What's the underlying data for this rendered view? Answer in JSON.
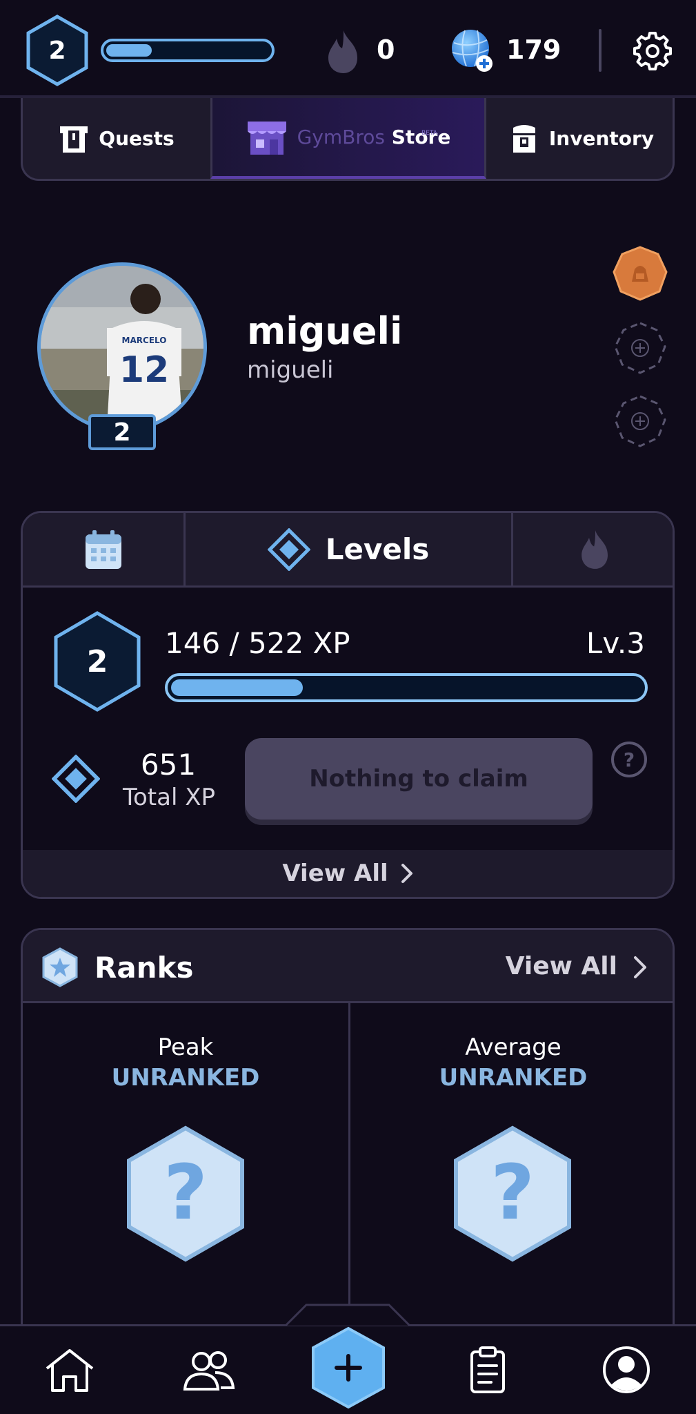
{
  "topbar": {
    "level": "2",
    "xp_fraction": 0.28,
    "streak_count": "0",
    "gems_count": "179"
  },
  "store_tabs": {
    "quests_label": "Quests",
    "store_label_a": "GymBros",
    "store_label_b": "Store",
    "store_beta": "BETA",
    "inventory_label": "Inventory"
  },
  "profile": {
    "display_name": "migueli",
    "username": "migueli",
    "level": "2",
    "jersey_name": "MARCELO",
    "jersey_number": "12"
  },
  "levels": {
    "tab_label": "Levels",
    "level": "2",
    "xp_progress": "146 / 522 XP",
    "xp_fraction": 0.28,
    "next_level": "Lv.3",
    "total_xp": "651",
    "total_xp_label": "Total XP",
    "claim_label": "Nothing to claim",
    "view_all": "View All"
  },
  "ranks": {
    "title": "Ranks",
    "view_all": "View All",
    "peak_label": "Peak",
    "peak_value": "UNRANKED",
    "average_label": "Average",
    "average_value": "UNRANKED"
  },
  "colors": {
    "background": "#0f0b1a",
    "accent_blue": "#6fb3ee",
    "card_header": "#1e1a2c",
    "store_purple": "#5b3fa8",
    "bronze_badge": "#d87a3c"
  },
  "icons": [
    "level-hex-icon",
    "flame-icon",
    "globe-gem-icon",
    "gear-icon",
    "quests-icon",
    "store-icon",
    "inventory-icon",
    "bronze-badge-icon",
    "add-badge-icon",
    "calendar-icon",
    "diamond-xp-icon",
    "help-icon",
    "chevron-right-icon",
    "star-hex-icon",
    "question-hex-icon",
    "home-icon",
    "friends-icon",
    "plus-icon",
    "clipboard-icon",
    "profile-icon"
  ]
}
